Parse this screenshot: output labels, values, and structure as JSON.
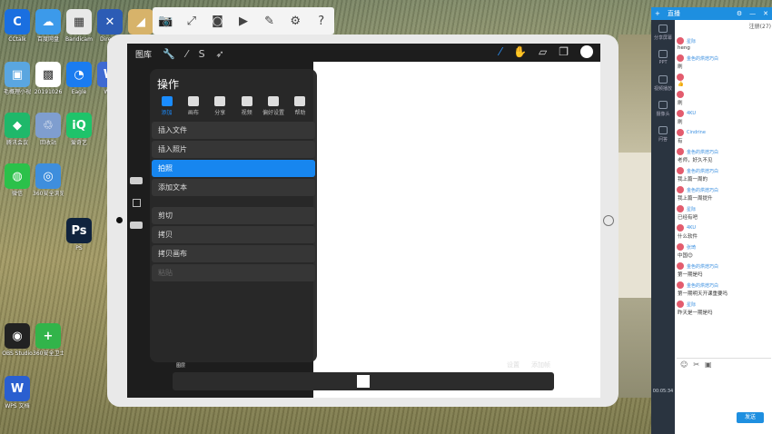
{
  "desktop_icons": [
    {
      "label": "CCtalk",
      "color": "#1a6fe0",
      "glyph": "C"
    },
    {
      "label": "百度网盘",
      "color": "#3c9aea",
      "glyph": "☁"
    },
    {
      "label": "Bandicam",
      "color": "#e8e8e8",
      "glyph": "▦"
    },
    {
      "label": "DirectX",
      "color": "#2c5cb5",
      "glyph": "✕"
    },
    {
      "label": "韩小冰",
      "color": "#d7b36a",
      "glyph": "◢"
    },
    {
      "label": "毛概理小视",
      "color": "#5aa6e0",
      "glyph": "▣"
    },
    {
      "label": "20191026",
      "color": "#ffffff",
      "glyph": "▩"
    },
    {
      "label": "Eagle",
      "color": "#1a7cf0",
      "glyph": "◔"
    },
    {
      "label": "WPS",
      "color": "#3e6ad2",
      "glyph": "W"
    },
    {
      "label": "腾讯会议",
      "color": "#1fb86a",
      "glyph": "◆"
    },
    {
      "label": "回收站",
      "color": "#7f9ecf",
      "glyph": "♲"
    },
    {
      "label": "爱奇艺",
      "color": "#1fc36a",
      "glyph": "iQ"
    },
    {
      "label": "微信",
      "color": "#2bc14a",
      "glyph": "◍"
    },
    {
      "label": "360安全浏览器",
      "color": "#3e8edd",
      "glyph": "◎"
    },
    {
      "label": "PS",
      "color": "#10233d",
      "glyph": "Ps"
    },
    {
      "label": "360安全卫士",
      "color": "#32b44a",
      "glyph": "+"
    },
    {
      "label": "OBS Studio",
      "color": "#222222",
      "glyph": "◉"
    },
    {
      "label": "WPS 文档",
      "color": "#2a5fd0",
      "glyph": "W"
    }
  ],
  "top_toolbar": {
    "items": [
      "camera-icon",
      "expand-icon",
      "photo-icon",
      "video-icon",
      "pen-icon",
      "gear-icon",
      "help-icon"
    ]
  },
  "app": {
    "gallery_label": "图库",
    "panel_title": "操作",
    "tabs": [
      {
        "label": "添加",
        "active": true
      },
      {
        "label": "画布",
        "active": false
      },
      {
        "label": "分享",
        "active": false
      },
      {
        "label": "视频",
        "active": false
      },
      {
        "label": "偏好设置",
        "active": false
      },
      {
        "label": "帮助",
        "active": false
      }
    ],
    "menu_items": [
      {
        "label": "插入文件",
        "state": "normal"
      },
      {
        "label": "插入照片",
        "state": "normal"
      },
      {
        "label": "拍照",
        "state": "selected"
      },
      {
        "label": "添加文本",
        "state": "normal"
      },
      {
        "label": "剪切",
        "state": "normal"
      },
      {
        "label": "拷贝",
        "state": "normal"
      },
      {
        "label": "拷贝画布",
        "state": "normal"
      },
      {
        "label": "粘贴",
        "state": "disabled"
      }
    ],
    "bottom": {
      "left_label": "图层",
      "settings_label": "设置",
      "add_frame_label": "添加帧"
    }
  },
  "chat": {
    "header_title": "直播",
    "viewer_count": "注册(27)",
    "nav_items": [
      "分享屏幕",
      "PPT",
      "视频播放",
      "摄像头",
      "问答"
    ],
    "messages": [
      {
        "user": "星际",
        "text": "heng"
      },
      {
        "user": "金色的烘焙巧白",
        "text": "刷"
      },
      {
        "user": "",
        "text": "👍"
      },
      {
        "user": "",
        "text": "刷"
      },
      {
        "user": "4KU",
        "text": "刷"
      },
      {
        "user": "Cindrine",
        "text": "有"
      },
      {
        "user": "金色的烘焙巧白",
        "text": "老师，好久不见"
      },
      {
        "user": "金色的烘焙巧白",
        "text": "我上篇一周的"
      },
      {
        "user": "金色的烘焙巧白",
        "text": "我上篇一周提升"
      },
      {
        "user": "星际",
        "text": "已经有吧"
      },
      {
        "user": "4KU",
        "text": "什么软件"
      },
      {
        "user": "张琦",
        "text": "中国😊"
      },
      {
        "user": "金色的烘焙巧白",
        "text": "第一期是吗"
      },
      {
        "user": "金色的烘焙巧白",
        "text": "第一期明天开课重要吗"
      },
      {
        "user": "星际",
        "text": "昨天是一期是吗"
      }
    ],
    "timer": "00:05:34",
    "send_label": "发送"
  }
}
